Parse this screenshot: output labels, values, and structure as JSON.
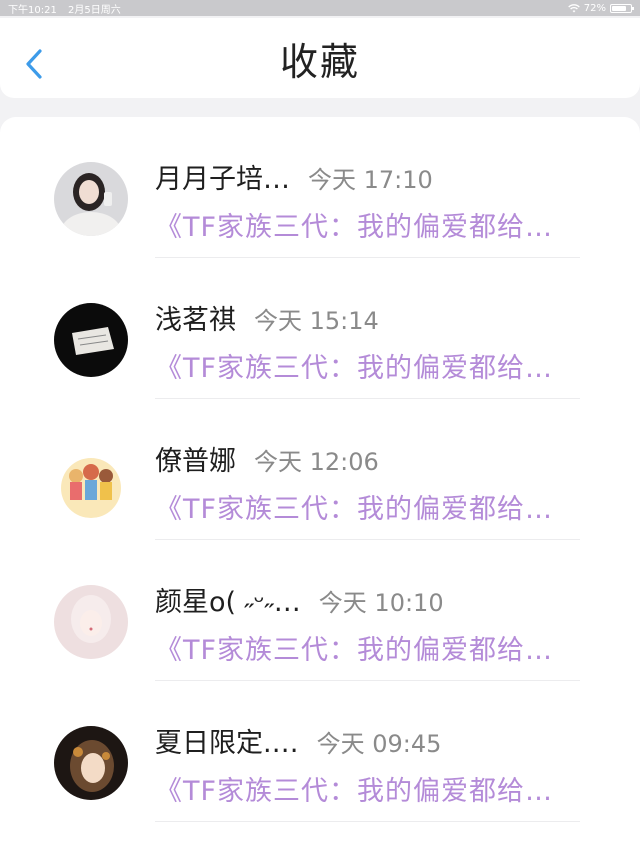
{
  "status_bar": {
    "time": "下午10:21",
    "date": "2月5日周六",
    "battery": "72%",
    "battery_level": 0.72
  },
  "nav": {
    "title": "收藏",
    "back_icon": "chevron-left-icon"
  },
  "items": [
    {
      "name": "月月子培…",
      "time": "今天 17:10",
      "preview": "《TF家族三代：我的偏爱都给…"
    },
    {
      "name": "浅茗祺",
      "time": "今天 15:14",
      "preview": "《TF家族三代：我的偏爱都给…"
    },
    {
      "name": "僚普娜",
      "time": "今天 12:06",
      "preview": "《TF家族三代：我的偏爱都给…"
    },
    {
      "name": "颜星o( ˶ᵕ˶…",
      "time": "今天 10:10",
      "preview": "《TF家族三代：我的偏爱都给…"
    },
    {
      "name": "夏日限定.…",
      "time": "今天 09:45",
      "preview": "《TF家族三代：我的偏爱都给…"
    }
  ],
  "colors": {
    "accent": "#3d9be9",
    "preview_purple": "#b48bd8"
  }
}
